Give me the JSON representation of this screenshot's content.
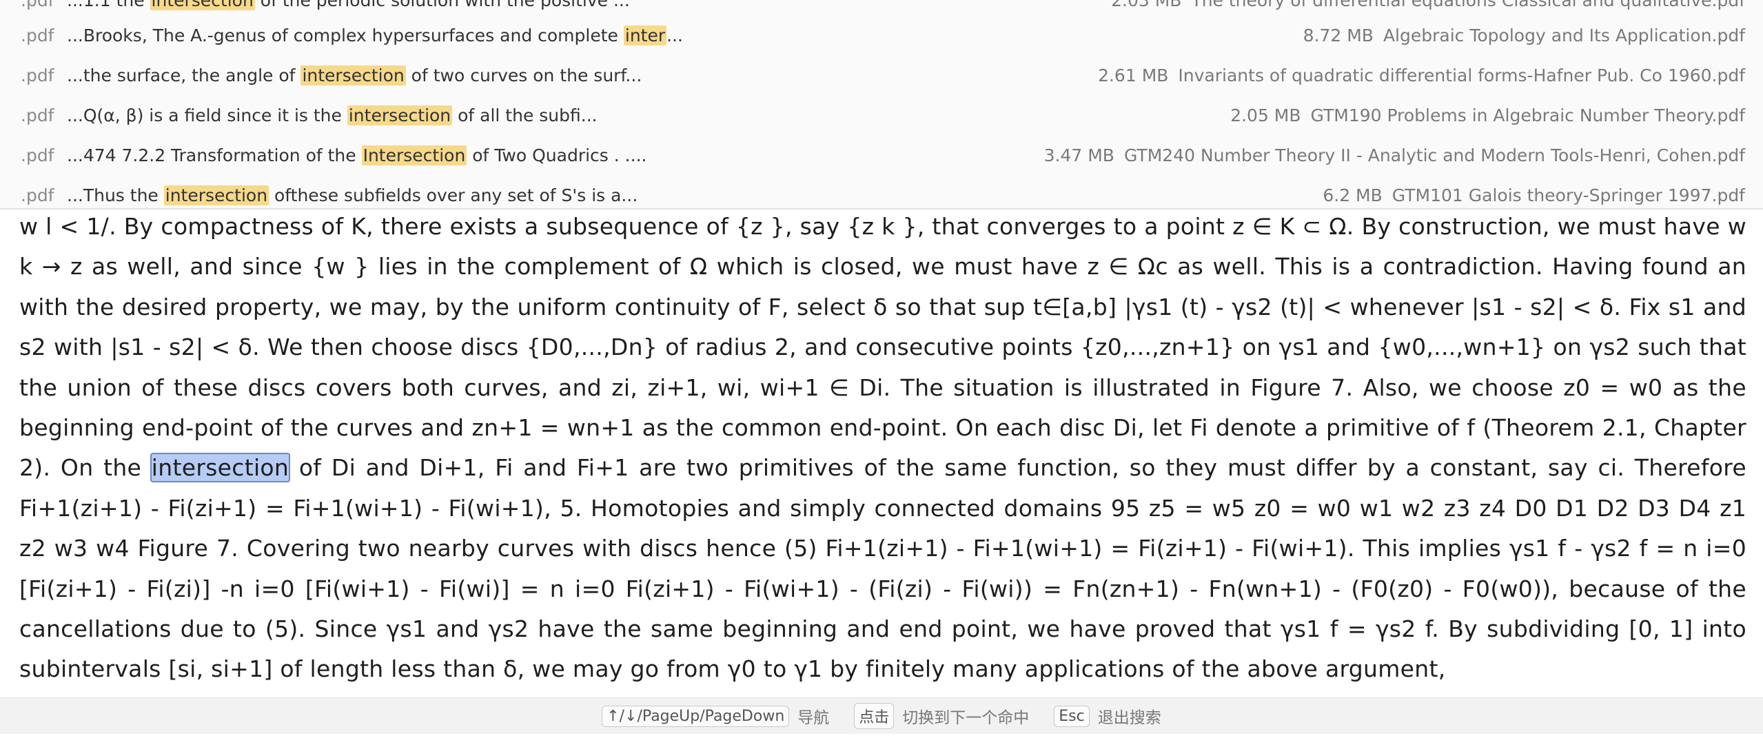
{
  "results": [
    {
      "ext": ".pdf",
      "before": "...1.1 the ",
      "match": "intersection",
      "after": " of the periodic solution with the positive ...",
      "size": "2.03 MB",
      "file": "The theory of differential equations Classical and qualitative.pdf"
    },
    {
      "ext": ".pdf",
      "before": "...Brooks, The A.-genus of complex hypersurfaces and complete ",
      "match": "inter",
      "after": "...",
      "size": "8.72 MB",
      "file": "Algebraic Topology and Its Application.pdf"
    },
    {
      "ext": ".pdf",
      "before": "...the surface, the angle of ",
      "match": "intersection",
      "after": " of two curves on the surf...",
      "size": "2.61 MB",
      "file": "Invariants of quadratic differential forms-Hafner Pub. Co 1960.pdf"
    },
    {
      "ext": ".pdf",
      "before": "...Q(α, β) is a field since it is the ",
      "match": "intersection",
      "after": " of all the subfi...",
      "size": "2.05 MB",
      "file": "GTM190 Problems in Algebraic Number Theory.pdf"
    },
    {
      "ext": ".pdf",
      "before": "...474 7.2.2 Transformation of the ",
      "match": "Intersection",
      "after": " of Two Quadrics . ....",
      "size": "3.47 MB",
      "file": "GTM240 Number Theory II - Analytic and Modern Tools-Henri, Cohen.pdf"
    },
    {
      "ext": ".pdf",
      "before": "...Thus the ",
      "match": "intersection",
      "after": " ofthese subfields over any set of S's is a...",
      "size": "6.2 MB",
      "file": "GTM101 Galois theory-Springer 1997.pdf"
    }
  ],
  "content": {
    "before": "w l < 1/. By compactness of K, there exists a subsequence of {z }, say {z k }, that converges to a point z ∈ K ⊂ Ω. By construction, we must have w k → z as well, and since {w } lies in the complement of Ω which is closed, we must have z ∈ Ωc as well. This is a contradiction. Having found an  with the desired property, we may, by the uniform continuity of F, select δ so that sup t∈[a,b] |γs1 (t) - γs2 (t)| <  whenever |s1 - s2| < δ. Fix s1 and s2 with |s1 - s2| < δ. We then choose discs {D0,...,Dn} of radius 2, and consecutive points {z0,...,zn+1} on γs1 and {w0,...,wn+1} on γs2 such that the union of these discs covers both curves, and zi, zi+1, wi, wi+1 ∈ Di. The situation is illustrated in Figure 7. Also, we choose z0 = w0 as the beginning end-point of the curves and zn+1 = wn+1 as the common end-point. On each disc Di, let Fi denote a primitive of f (Theorem 2.1, Chapter 2). On the ",
    "match": "intersection",
    "after": " of Di and Di+1, Fi and Fi+1 are two primitives of the same function, so they must differ by a constant, say ci. Therefore Fi+1(zi+1) - Fi(zi+1) = Fi+1(wi+1) - Fi(wi+1), 5. Homotopies and simply connected domains 95 z5 = w5 z0 = w0 w1 w2 z3 z4 D0 D1 D2 D3 D4 z1 z2 w3 w4 Figure 7. Covering two nearby curves with discs hence (5) Fi+1(zi+1) - Fi+1(wi+1) = Fi(zi+1) - Fi(wi+1). This implies  γs1 f - γs2 f = n i=0 [Fi(zi+1) - Fi(zi)] -n i=0 [Fi(wi+1) - Fi(wi)] = n i=0 Fi(zi+1) - Fi(wi+1) - (Fi(zi) - Fi(wi)) = Fn(zn+1) - Fn(wn+1) - (F0(z0) - F0(w0)), because of the cancellations due to (5). Since γs1 and γs2 have the same beginning and end point, we have proved that  γs1 f =  γs2 f. By subdividing [0, 1] into subintervals [si, si+1] of length less than δ, we may go from γ0 to γ1 by finitely many applications of the above argument,"
  },
  "hints": {
    "nav_key": "↑/↓/PageUp/PageDown",
    "nav_label": "导航",
    "click_key": "点击",
    "click_label": "切换到下一个命中",
    "esc_key": "Esc",
    "esc_label": "退出搜索"
  }
}
